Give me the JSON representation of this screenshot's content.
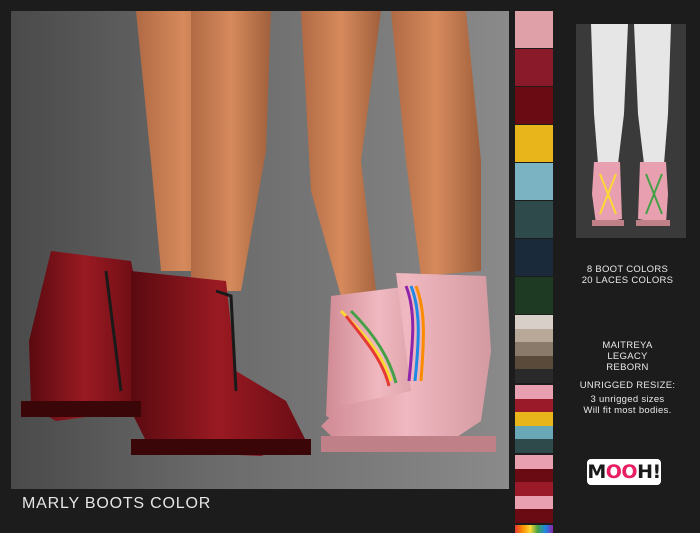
{
  "title": "MARLY BOOTS COLOR",
  "info": {
    "boot_colors": "8 BOOT COLORS",
    "laces_colors": "20 LACES COLORS",
    "bodies": [
      "MAITREYA",
      "LEGACY",
      "REBORN"
    ],
    "unrigged_heading": "UNRIGGED RESIZE:",
    "unrigged_lines": [
      "3 unrigged sizes",
      "Will fit most bodies."
    ]
  },
  "logo": {
    "text_a": "M",
    "text_b": "OO",
    "text_c": "H!"
  },
  "boot_swatches": [
    "#e0a0a8",
    "#8a1a2a",
    "#6a0a12",
    "#e8b51a",
    "#7cb3c2",
    "#2f4a4a",
    "#1a2a3a",
    "#1f3a22"
  ],
  "lace_groups": [
    [
      "#d8d0c8",
      "#b8a898",
      "#8a7a6a",
      "#5a4a3a",
      "#2a2a2a"
    ],
    [
      "#e8a0b0",
      "#9a1a2a",
      "#e8b51a",
      "#6aa8b8",
      "#2f4a4a"
    ],
    [
      "#e8a0b0",
      "#6a0a12",
      "#9a1a2a",
      "#e8a0b0",
      "#6a0a12"
    ]
  ],
  "icons": {
    "photo": "boots-photo",
    "preview": "legs-preview-image",
    "rainbow": "rainbow-lace-swatch"
  }
}
